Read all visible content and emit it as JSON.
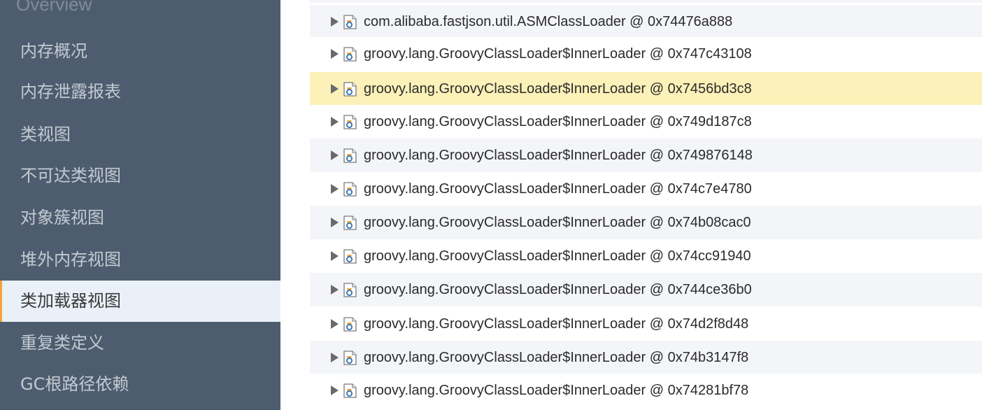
{
  "sidebar": {
    "header": "Overview",
    "items": [
      {
        "label": "内存概况"
      },
      {
        "label": "内存泄露报表"
      },
      {
        "label": "类视图"
      },
      {
        "label": "不可达类视图"
      },
      {
        "label": "对象簇视图"
      },
      {
        "label": "堆外内存视图"
      },
      {
        "label": "类加载器视图",
        "active": true
      },
      {
        "label": "重复类定义"
      },
      {
        "label": "GC根路径依赖"
      }
    ]
  },
  "tree": {
    "icon": "object-file-icon",
    "expander_icon": "triangle-right-icon",
    "rows": [
      {
        "label": "com.alibaba.fastjson.util.ASMClassLoader @ 0x74476a888"
      },
      {
        "label": "groovy.lang.GroovyClassLoader$InnerLoader @ 0x747c43108"
      },
      {
        "label": "groovy.lang.GroovyClassLoader$InnerLoader @ 0x7456bd3c8",
        "selected": true
      },
      {
        "label": "groovy.lang.GroovyClassLoader$InnerLoader @ 0x749d187c8"
      },
      {
        "label": "groovy.lang.GroovyClassLoader$InnerLoader @ 0x749876148"
      },
      {
        "label": "groovy.lang.GroovyClassLoader$InnerLoader @ 0x74c7e4780"
      },
      {
        "label": "groovy.lang.GroovyClassLoader$InnerLoader @ 0x74b08cac0"
      },
      {
        "label": "groovy.lang.GroovyClassLoader$InnerLoader @ 0x74cc91940"
      },
      {
        "label": "groovy.lang.GroovyClassLoader$InnerLoader @ 0x744ce36b0"
      },
      {
        "label": "groovy.lang.GroovyClassLoader$InnerLoader @ 0x74d2f8d48"
      },
      {
        "label": "groovy.lang.GroovyClassLoader$InnerLoader @ 0x74b3147f8"
      },
      {
        "label": "groovy.lang.GroovyClassLoader$InnerLoader @ 0x74281bf78"
      }
    ]
  },
  "colors": {
    "sidebar_bg": "#4d5d6f",
    "active_item_bg": "#e9f0f8",
    "accent": "#f2a33a",
    "selected_row": "#fcf1b8"
  }
}
